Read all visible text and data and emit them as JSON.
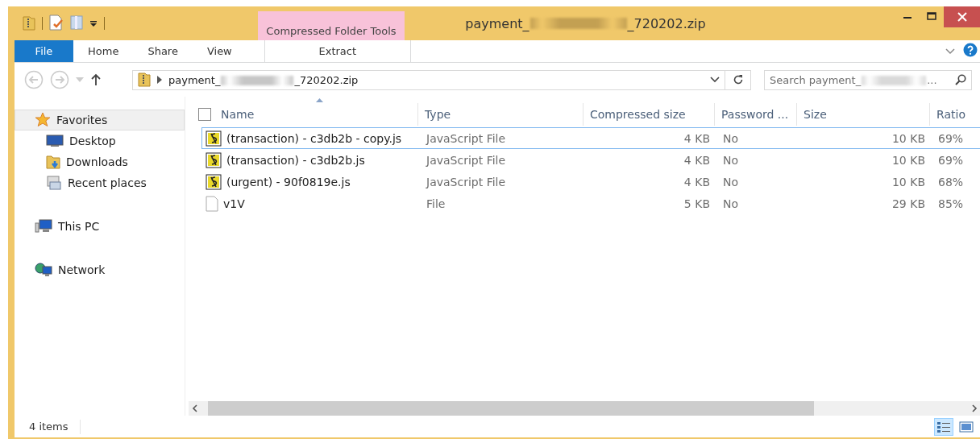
{
  "window": {
    "title_start": "payment_",
    "title_redacted": true,
    "title_end": "_720202.zip"
  },
  "context_tab_group": "Compressed Folder Tools",
  "ribbon_tabs": [
    {
      "label": "File",
      "kind": "file",
      "selected": false
    },
    {
      "label": "Home",
      "kind": "plain",
      "selected": false
    },
    {
      "label": "Share",
      "kind": "plain",
      "selected": false
    },
    {
      "label": "View",
      "kind": "plain",
      "selected": false
    },
    {
      "label": "Extract",
      "kind": "context",
      "selected": false
    }
  ],
  "address": {
    "path_start": "payment_",
    "path_redacted": true,
    "path_end": "_720202.zip"
  },
  "search": {
    "placeholder_start": "Search payment_",
    "placeholder_redacted": true,
    "placeholder_end": "..."
  },
  "sidebar": {
    "items": [
      {
        "label": "Favorites",
        "kind": "group",
        "selected": true
      },
      {
        "label": "Desktop",
        "kind": "place",
        "selected": false
      },
      {
        "label": "Downloads",
        "kind": "place",
        "selected": false
      },
      {
        "label": "Recent places",
        "kind": "place",
        "selected": false
      },
      {
        "label": "This PC",
        "kind": "group",
        "selected": false
      },
      {
        "label": "Network",
        "kind": "group",
        "selected": false
      }
    ]
  },
  "table": {
    "select_all_checked": false,
    "columns": [
      "Name",
      "Type",
      "Compressed size",
      "Password ...",
      "Size",
      "Ratio"
    ],
    "rows": [
      {
        "kind": "script",
        "selected": true,
        "cells": [
          "(transaction) - c3db2b - copy.js",
          "JavaScript File",
          "4 KB",
          "No",
          "10 KB",
          "69%"
        ]
      },
      {
        "kind": "script",
        "selected": false,
        "cells": [
          "(transaction) - c3db2b.js",
          "JavaScript File",
          "4 KB",
          "No",
          "10 KB",
          "69%"
        ]
      },
      {
        "kind": "script",
        "selected": false,
        "cells": [
          "(urgent) - 90f0819e.js",
          "JavaScript File",
          "4 KB",
          "No",
          "10 KB",
          "68%"
        ]
      },
      {
        "kind": "file",
        "selected": false,
        "cells": [
          "v1V",
          "File",
          "5 KB",
          "No",
          "29 KB",
          "85%"
        ]
      }
    ]
  },
  "status_bar": {
    "item_count": "4 items",
    "view_buttons": [
      {
        "selected": true
      },
      {
        "selected": false
      }
    ]
  }
}
